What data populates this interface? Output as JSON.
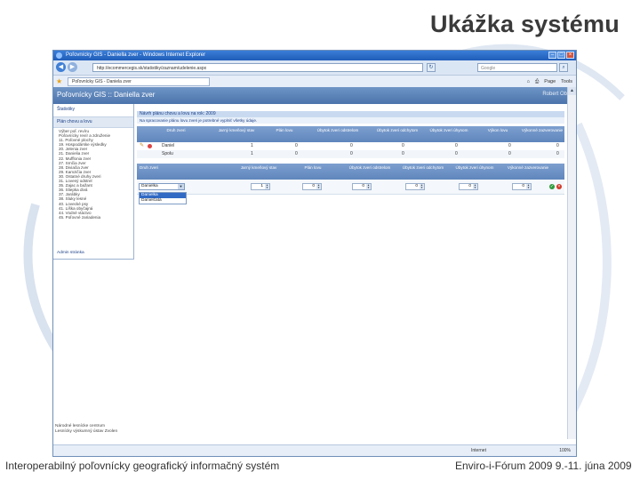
{
  "slide": {
    "title": "Ukážka systému",
    "footer_left": "Interoperabilný poľovnícky geografický informačný systém",
    "footer_right": "Enviro-i-Fórum 2009 9.-11. júna 2009"
  },
  "browser": {
    "window_title": "Poľovnícky GIS - Daniella zver - Windows Internet Explorer",
    "url": "http://ecommercegis.sk/statistiky/zaznam/udelenie.aspx",
    "search_placeholder": "Google",
    "tab_title": "Poľovnícky GIS - Daniela zver",
    "tools": {
      "page": "Page",
      "tools": "Tools"
    },
    "status_zone": "Internet",
    "status_zoom": "100%"
  },
  "app": {
    "name": "Poľovnícky GIS :: Daniella zver",
    "user": "Robert Oboll",
    "sidebar": {
      "top_link": "Štatistiky",
      "active_item": "Plán chovu a lovu",
      "items": [
        "Výber poľ. revíru",
        "Poľovnícky revír a združenie",
        "11. Poľovné plochy",
        "19. Hospodárske výsledky",
        "20. Jelenia zver",
        "21. Danielia zver",
        "22. Mufflonia zver",
        "27. Srnčia zver",
        "28. Diviačia zver",
        "29. Kamzičia zver",
        "30. Ostatné druhy zveri",
        "31. Lovený odstrel",
        "35. Zajac a bažant",
        "36. Sliepka divá",
        "37. Jarábky",
        "38. Sluky lesné",
        "40. Lovecké psy",
        "41. Líška obyčajná",
        "44. Vodné vtáctvo",
        "45. Poľovné zariadenia"
      ],
      "footer_link": "Admin stránka"
    },
    "bottom_lines": [
      "Národné lesnícke centrum",
      "Lesnícky výskumný ústav Zvolen"
    ],
    "info_head": "Návrh plánu chovu a lovu na rok: 2009",
    "info_sub": "Na spracovanie plánu lovu zveri je potrebné vyplniť všetky údaje.",
    "grid": {
      "headers": [
        "Druh zveri",
        "Jarný kmeňový stav",
        "Plán lovu",
        "Úbytok zveri odstrelom",
        "Úbytok zveri odchytom",
        "Úbytok zveri úhynom",
        "Výkon lovu",
        "Výkonné zazverovanie"
      ],
      "rows": [
        {
          "name": "Daniel",
          "values": [
            "1",
            "0",
            "0",
            "0",
            "0",
            "0",
            "0"
          ]
        },
        {
          "name": "Spolu",
          "values": [
            "1",
            "0",
            "0",
            "0",
            "0",
            "0",
            "0"
          ]
        }
      ]
    },
    "edit": {
      "headers": [
        "Druh zveri",
        "Jarný kmeňový stav",
        "Plán lovu",
        "Úbytok zveri odstrelom",
        "Úbytok zveri odchytom",
        "Úbytok zveri úhynom",
        "Výkonné zazverovanie"
      ],
      "select_value": "Danielka",
      "options": [
        "Danielka",
        "Danielčatá"
      ],
      "spin_values": [
        "1",
        "0",
        "0",
        "0",
        "0",
        "0"
      ]
    }
  }
}
